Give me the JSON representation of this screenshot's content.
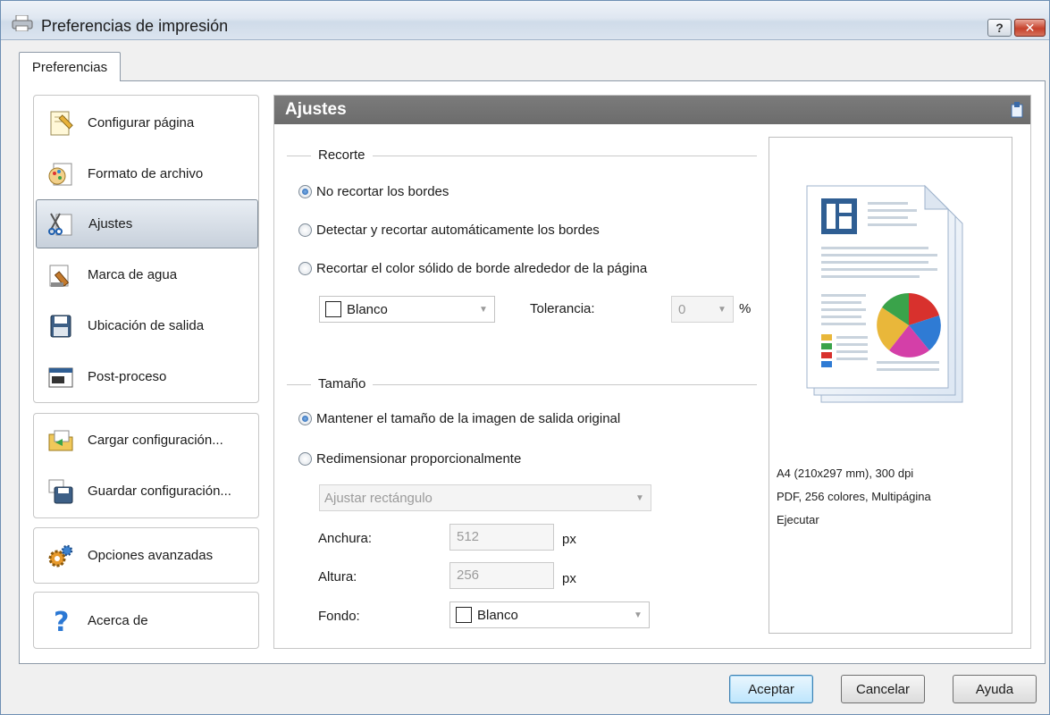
{
  "window": {
    "title": "Preferencias de impresión"
  },
  "tabs": [
    {
      "label": "Preferencias"
    }
  ],
  "nav": {
    "group1": [
      {
        "label": "Configurar página",
        "icon": "page-setup-icon"
      },
      {
        "label": "Formato de archivo",
        "icon": "file-format-icon"
      },
      {
        "label": "Ajustes",
        "icon": "adjustments-icon",
        "selected": true
      },
      {
        "label": "Marca de agua",
        "icon": "watermark-icon"
      },
      {
        "label": "Ubicación de salida",
        "icon": "save-location-icon"
      },
      {
        "label": "Post-proceso",
        "icon": "post-process-icon"
      }
    ],
    "group2": [
      {
        "label": "Cargar configuración...",
        "icon": "load-config-icon"
      },
      {
        "label": "Guardar configuración...",
        "icon": "save-config-icon"
      }
    ],
    "group3": [
      {
        "label": "Opciones avanzadas",
        "icon": "gears-icon"
      }
    ],
    "group4": [
      {
        "label": "Acerca de",
        "icon": "help-icon"
      }
    ]
  },
  "section": {
    "title": "Ajustes",
    "crop": {
      "label": "Recorte",
      "options": [
        {
          "label": "No recortar los bordes",
          "checked": true
        },
        {
          "label": "Detectar y recortar automáticamente los bordes",
          "checked": false
        },
        {
          "label": "Recortar el color sólido de borde alrededor de la página",
          "checked": false
        }
      ],
      "color_value": "Blanco",
      "tolerance_label": "Tolerancia:",
      "tolerance_value": "0",
      "tolerance_unit": "%"
    },
    "size": {
      "label": "Tamaño",
      "options": [
        {
          "label": "Mantener el tamaño de la imagen de salida original",
          "checked": true
        },
        {
          "label": "Redimensionar proporcionalmente",
          "checked": false
        }
      ],
      "fit_value": "Ajustar rectángulo",
      "width_label": "Anchura:",
      "width_value": "512",
      "width_unit": "px",
      "height_label": "Altura:",
      "height_value": "256",
      "height_unit": "px",
      "background_label": "Fondo:",
      "background_value": "Blanco"
    }
  },
  "preview": {
    "line1": "A4 (210x297 mm), 300 dpi",
    "line2": "PDF, 256 colores, Multipágina",
    "line3": "Ejecutar"
  },
  "buttons": {
    "ok": "Aceptar",
    "cancel": "Cancelar",
    "help": "Ayuda"
  },
  "colors": {
    "accent": "#1f5fae",
    "header_bg": "#707070",
    "selected_nav": "#c7d0db"
  }
}
